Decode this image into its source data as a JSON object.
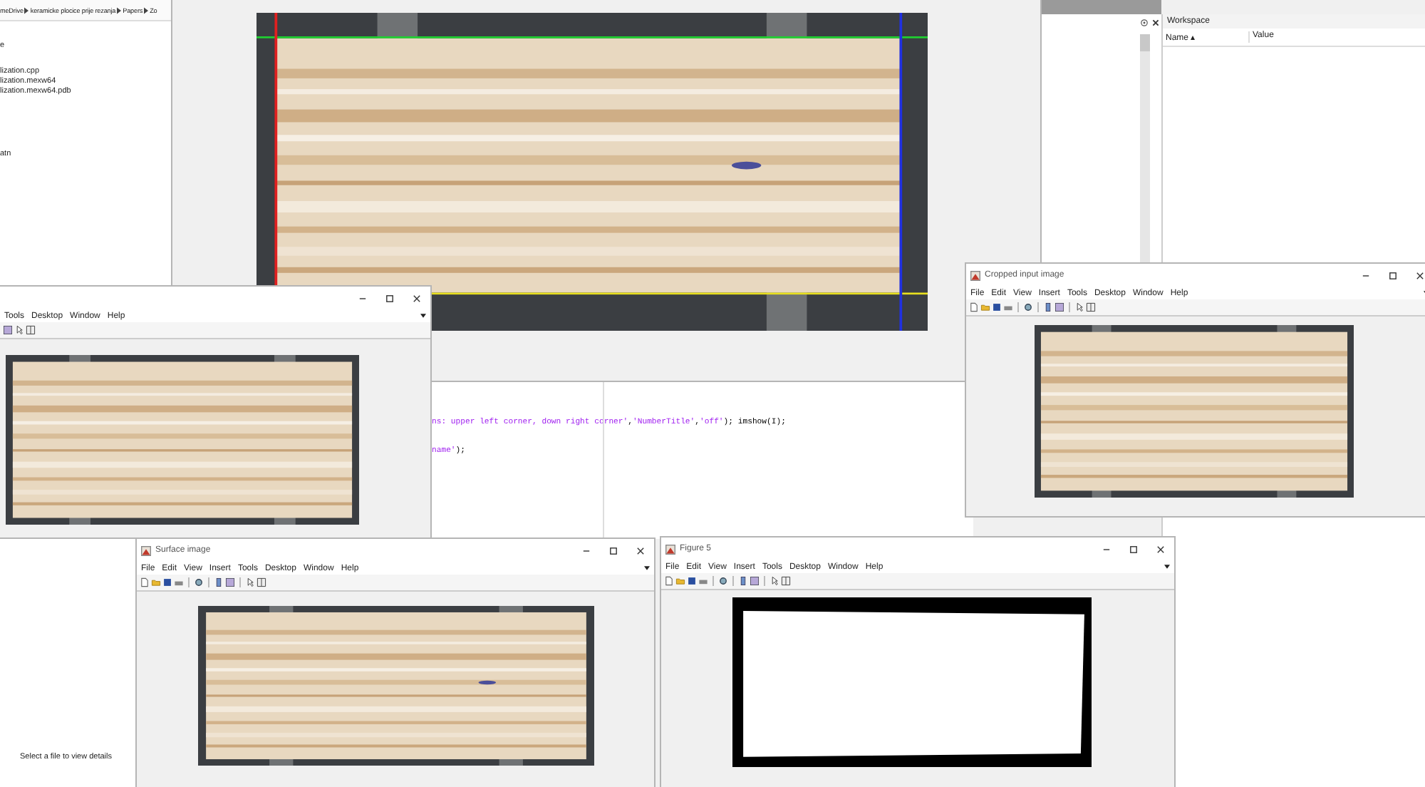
{
  "path_bar": {
    "crumbs": [
      "meDrive",
      "keramicke plocice prije rezanja",
      "Papers",
      "Zo"
    ]
  },
  "files": [
    "e",
    "lization.cpp",
    "lization.mexw64",
    "lization.mexw64.pdb",
    "atn"
  ],
  "details_hint": "Select a file to view details",
  "code_lines": [
    {
      "segments": [
        {
          "kind": "string",
          "text": "ns: upper left corner, down right corner'"
        },
        {
          "kind": "plain",
          "text": ","
        },
        {
          "kind": "string",
          "text": "'NumberTitle'"
        },
        {
          "kind": "plain",
          "text": ","
        },
        {
          "kind": "string",
          "text": "'off'"
        },
        {
          "kind": "plain",
          "text": "); imshow(I);"
        }
      ]
    },
    {
      "segments": [
        {
          "kind": "string",
          "text": "name'"
        },
        {
          "kind": "plain",
          "text": ");"
        }
      ]
    }
  ],
  "workspace": {
    "title": "Workspace",
    "columns": [
      "Name ▴",
      "Value"
    ]
  },
  "figures": [
    {
      "image": {
        "kind": "picture"
      }
    },
    {
      "menu": [
        "Tools",
        "Desktop",
        "Window",
        "Help"
      ],
      "cut_off": true,
      "image": {
        "kind": "picture"
      }
    },
    {
      "title": "Cropped input image",
      "menu": [
        "File",
        "Edit",
        "View",
        "Insert",
        "Tools",
        "Desktop",
        "Window",
        "Help"
      ],
      "cut_off": false,
      "image": {
        "kind": "picture"
      }
    },
    {
      "title": "Surface image",
      "menu": [
        "File",
        "Edit",
        "View",
        "Insert",
        "Tools",
        "Desktop",
        "Window",
        "Help"
      ],
      "cut_off": false,
      "image": {
        "kind": "picture"
      }
    },
    {
      "title": "Figure 5",
      "menu": [
        "File",
        "Edit",
        "View",
        "Insert",
        "Tools",
        "Desktop",
        "Window",
        "Help"
      ],
      "cut_off": false,
      "image": {
        "kind": "mask"
      }
    }
  ]
}
